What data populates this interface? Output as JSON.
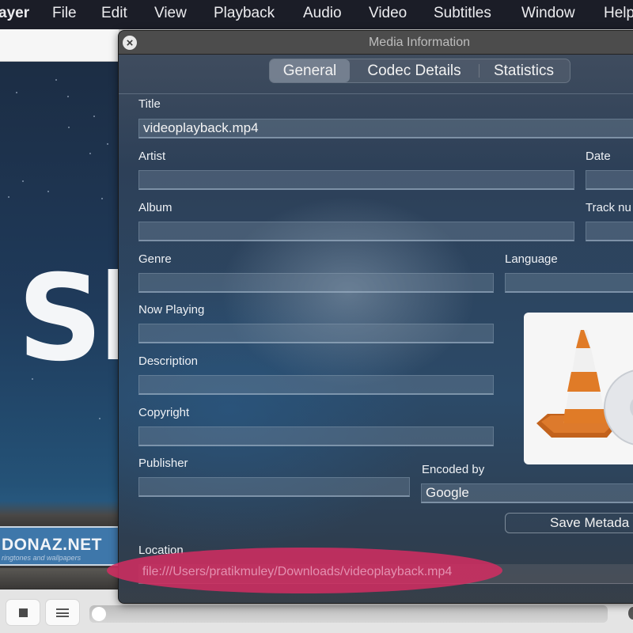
{
  "menubar": {
    "app_name_partial": "ayer",
    "items": [
      "File",
      "Edit",
      "View",
      "Playback",
      "Audio",
      "Video",
      "Subtitles",
      "Window",
      "Help"
    ]
  },
  "video": {
    "overlay_text": "Sh",
    "banner_title": "DONAZ.NET",
    "banner_subtitle": "ringtones and wallpapers"
  },
  "dialog": {
    "title": "Media Information",
    "close_icon": "close-x-circle",
    "tabs": [
      {
        "label": "General",
        "active": true
      },
      {
        "label": "Codec Details",
        "active": false
      },
      {
        "label": "Statistics",
        "active": false
      }
    ],
    "fields": {
      "title": {
        "label": "Title",
        "value": "videoplayback.mp4"
      },
      "artist": {
        "label": "Artist",
        "value": ""
      },
      "date": {
        "label": "Date",
        "value": ""
      },
      "album": {
        "label": "Album",
        "value": ""
      },
      "track_number": {
        "label": "Track nu",
        "value": ""
      },
      "genre": {
        "label": "Genre",
        "value": ""
      },
      "language": {
        "label": "Language",
        "value": ""
      },
      "now_playing": {
        "label": "Now Playing",
        "value": ""
      },
      "description": {
        "label": "Description",
        "value": ""
      },
      "copyright": {
        "label": "Copyright",
        "value": ""
      },
      "publisher": {
        "label": "Publisher",
        "value": ""
      },
      "encoded_by": {
        "label": "Encoded by",
        "value": "Google"
      },
      "location": {
        "label": "Location",
        "value": "file:///Users/pratikmuley/Downloads/videoplayback.mp4"
      }
    },
    "artwork_icon": "vlc-cone-icon",
    "save_button": "Save Metada",
    "highlight_color": "#d42d62"
  },
  "controls": {
    "stop_icon": "stop-icon",
    "playlist_icon": "playlist-icon",
    "seek_progress": 0
  }
}
